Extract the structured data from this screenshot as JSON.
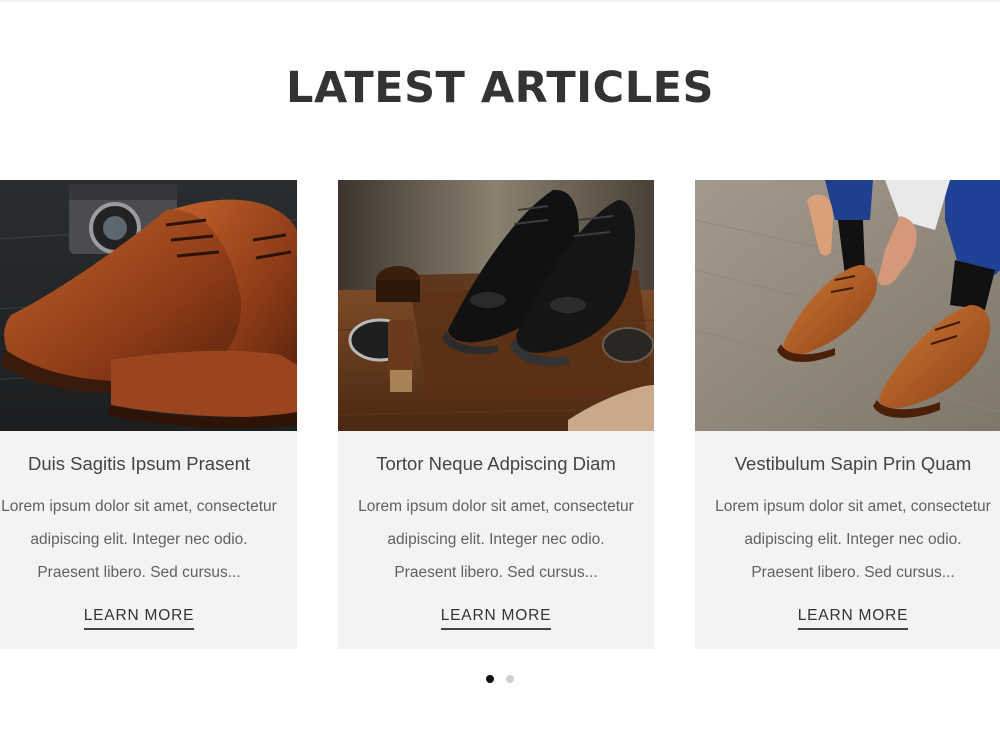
{
  "section": {
    "title": "LATEST ARTICLES"
  },
  "articles": [
    {
      "title": "Duis Sagitis Ipsum Prasent",
      "excerpt": "Lorem ipsum dolor sit amet, consectetur adipiscing elit. Integer nec odio. Praesent libero. Sed cursus...",
      "cta": "LEARN MORE",
      "image": "brown-leather-shoes-with-camera"
    },
    {
      "title": "Tortor Neque Adpiscing Diam",
      "excerpt": "Lorem ipsum dolor sit amet, consectetur adipiscing elit. Integer nec odio. Praesent libero. Sed cursus...",
      "cta": "LEARN MORE",
      "image": "black-shoes-with-polish-kit"
    },
    {
      "title": "Vestibulum Sapin Prin Quam",
      "excerpt": "Lorem ipsum dolor sit amet, consectetur adipiscing elit. Integer nec odio. Praesent libero. Sed cursus...",
      "cta": "LEARN MORE",
      "image": "man-tying-brown-shoes"
    }
  ],
  "pager": {
    "pages": 2,
    "active": 1
  },
  "colors": {
    "title": "#333333",
    "card_background": "#f3f3f3",
    "text": "#616161",
    "dot_active": "#111111",
    "dot_inactive": "#cfcfcf"
  }
}
